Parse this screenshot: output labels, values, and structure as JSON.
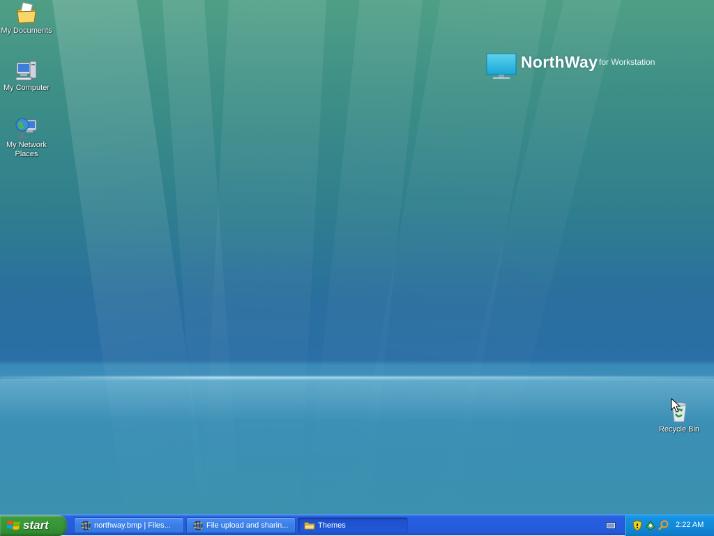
{
  "desktop": {
    "icons": [
      {
        "label": "My Documents",
        "icon": "my-documents-icon"
      },
      {
        "label": "My Computer",
        "icon": "my-computer-icon"
      },
      {
        "label": "My Network Places",
        "icon": "my-network-places-icon"
      },
      {
        "label": "Recycle Bin",
        "icon": "recycle-bin-icon"
      }
    ],
    "logo": {
      "brand": "NorthWay",
      "tagline": "for Workstation",
      "icon": "monitor-icon"
    }
  },
  "taskbar": {
    "start_label": "start",
    "tasks": [
      {
        "label": "northway.bmp | Files...",
        "icon": "browser-icon",
        "active": false
      },
      {
        "label": "File upload and sharin...",
        "icon": "browser-icon",
        "active": false
      },
      {
        "label": "Themes",
        "icon": "folder-icon",
        "active": true
      }
    ],
    "tray": {
      "icons": [
        "keyboard-icon",
        "security-shield-icon",
        "network-icon",
        "search-icon"
      ],
      "clock": "2:22 AM"
    }
  },
  "colors": {
    "taskbar": "#245de0",
    "start_button": "#379737",
    "tray": "#1188d8"
  }
}
